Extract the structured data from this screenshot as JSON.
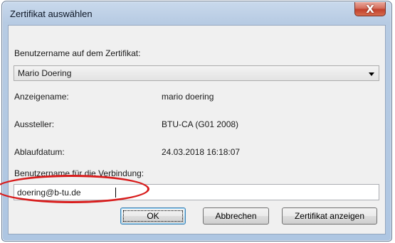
{
  "window": {
    "title": "Zertifikat auswählen",
    "close_label": "X"
  },
  "form": {
    "username_label": "Benutzername auf dem Zertifikat:",
    "username_value": "Mario Doering",
    "display_name_label": "Anzeigename:",
    "display_name_value": "mario doering",
    "issuer_label": "Aussteller:",
    "issuer_value": "BTU-CA (G01 2008)",
    "expiry_label": "Ablaufdatum:",
    "expiry_value": "24.03.2018 16:18:07",
    "connection_label": "Benutzername für die Verbindung:",
    "connection_value": "doering@b-tu.de"
  },
  "buttons": {
    "ok": "OK",
    "cancel": "Abbrechen",
    "show_certificate": "Zertifikat anzeigen"
  },
  "colors": {
    "annotation": "#d81c1c",
    "frame": "#b7cbe3",
    "close_button": "#c2412c"
  },
  "icons": {
    "close": "close-icon",
    "dropdown": "chevron-down-icon"
  }
}
